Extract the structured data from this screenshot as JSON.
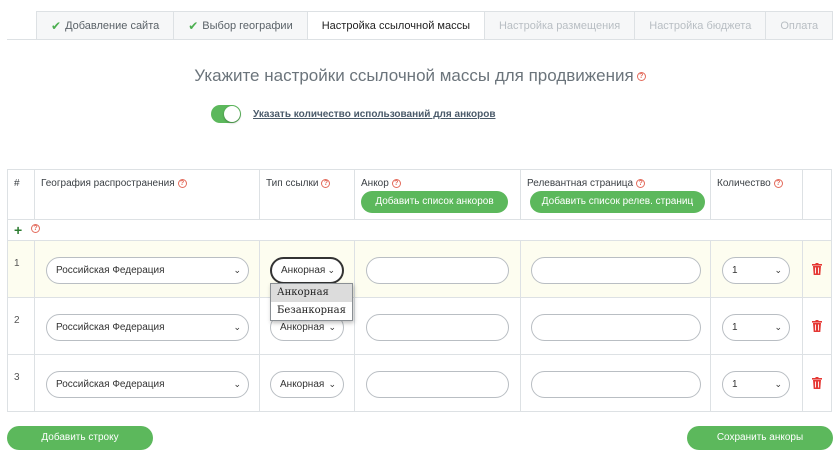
{
  "tabs": [
    {
      "label": "Добавление сайта",
      "state": "done"
    },
    {
      "label": "Выбор географии",
      "state": "done"
    },
    {
      "label": "Настройка ссылочной массы",
      "state": "active"
    },
    {
      "label": "Настройка размещения",
      "state": "disabled"
    },
    {
      "label": "Настройка бюджета",
      "state": "disabled"
    },
    {
      "label": "Оплата",
      "state": "disabled"
    }
  ],
  "heading": "Укажите настройки ссылочной массы для продвижения",
  "toggle": {
    "label": "Указать количество использований для анкоров",
    "on": true
  },
  "table": {
    "headers": {
      "num": "#",
      "geo": "География распространения",
      "link_type": "Тип ссылки",
      "anchor": "Анкор",
      "page": "Релевантная страница",
      "qty": "Количество"
    },
    "anchor_button": "Добавить список анкоров",
    "page_button": "Добавить список релев. страниц",
    "rows": [
      {
        "num": "1",
        "geo": "Российская Федерация",
        "link_type": "Анкорная",
        "anchor": "",
        "page": "",
        "qty": "1"
      },
      {
        "num": "2",
        "geo": "Российская Федерация",
        "link_type": "Анкорная",
        "anchor": "",
        "page": "",
        "qty": "1"
      },
      {
        "num": "3",
        "geo": "Российская Федерация",
        "link_type": "Анкорная",
        "anchor": "",
        "page": "",
        "qty": "1"
      }
    ]
  },
  "dropdown": {
    "options": [
      "Анкорная",
      "Безанкорная"
    ],
    "highlighted": "Анкорная"
  },
  "buttons": {
    "add_row": "Добавить строку",
    "save": "Сохранить анкоры"
  },
  "colors": {
    "accent": "#5cb85c",
    "help": "#e36b5c",
    "trash": "#e53935"
  },
  "icons": {
    "check": "✔",
    "plus": "+",
    "help": "?",
    "caret": "⌄"
  }
}
